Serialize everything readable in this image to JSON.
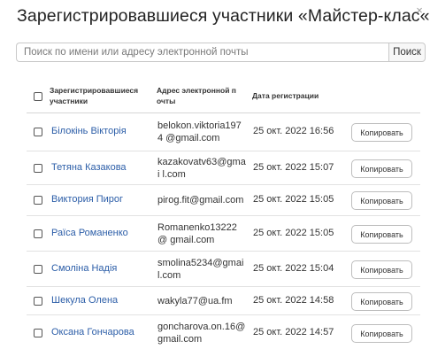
{
  "modal": {
    "title": "Зарегистрировавшиеся участники «Майстер-клас«",
    "close_label": "×"
  },
  "search": {
    "placeholder": "Поиск по имени или адресу электронной почты",
    "value": "",
    "button_label": "Поиск"
  },
  "table": {
    "columns": {
      "name": "Зарегистрировавшиеся участники",
      "email": "Адрес электронной п очты",
      "date": "Дата регистрации"
    },
    "copy_label": "Копировать",
    "rows": [
      {
        "name": "Білокінь Вікторія",
        "email": "belokon.viktoria1974 @gmail.com",
        "date": "25 окт. 2022 16:56"
      },
      {
        "name": "Тетяна Казакова",
        "email": "kazakovatv63@gmai l.com",
        "date": "25 окт. 2022 15:07"
      },
      {
        "name": "Виктория Пирог",
        "email": "pirog.fit@gmail.com",
        "date": "25 окт. 2022 15:05"
      },
      {
        "name": "Раїса Романенко",
        "email": "Romanenko13222@ gmail.com",
        "date": "25 окт. 2022 15:05"
      },
      {
        "name": "Смоліна Надія",
        "email": "smolina5234@gmai l.com",
        "date": "25 окт. 2022 15:04"
      },
      {
        "name": "Шекула Олена",
        "email": "wakyla77@ua.fm",
        "date": "25 окт. 2022 14:58"
      },
      {
        "name": "Оксана Гончарова",
        "email": "goncharova.on.16@ gmail.com",
        "date": "25 окт. 2022 14:57"
      }
    ]
  }
}
